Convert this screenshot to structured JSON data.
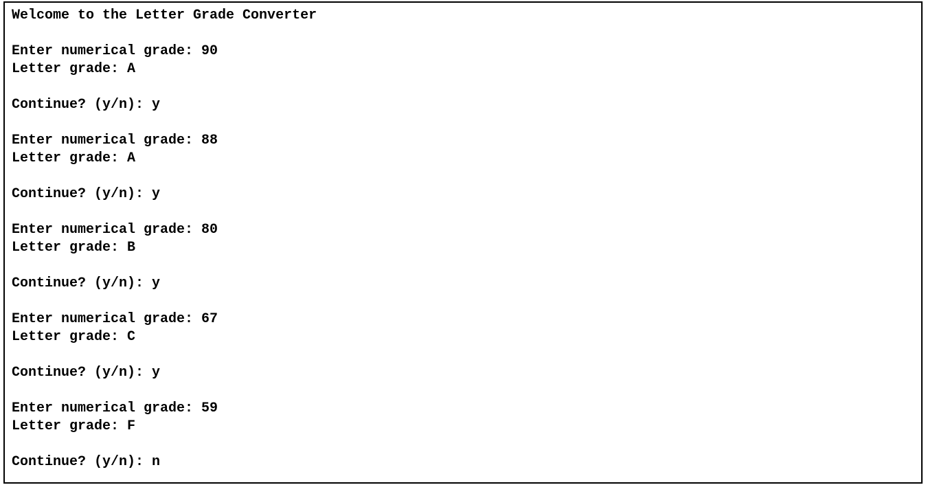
{
  "title": "Welcome to the Letter Grade Converter",
  "prompts": {
    "enterGrade": "Enter numerical grade: ",
    "letterGrade": "Letter grade: ",
    "continue": "Continue? (y/n): "
  },
  "rounds": [
    {
      "input": "90",
      "letter": "A",
      "cont": "y"
    },
    {
      "input": "88",
      "letter": "A",
      "cont": "y"
    },
    {
      "input": "80",
      "letter": "B",
      "cont": "y"
    },
    {
      "input": "67",
      "letter": "C",
      "cont": "y"
    },
    {
      "input": "59",
      "letter": "F",
      "cont": "n"
    }
  ]
}
